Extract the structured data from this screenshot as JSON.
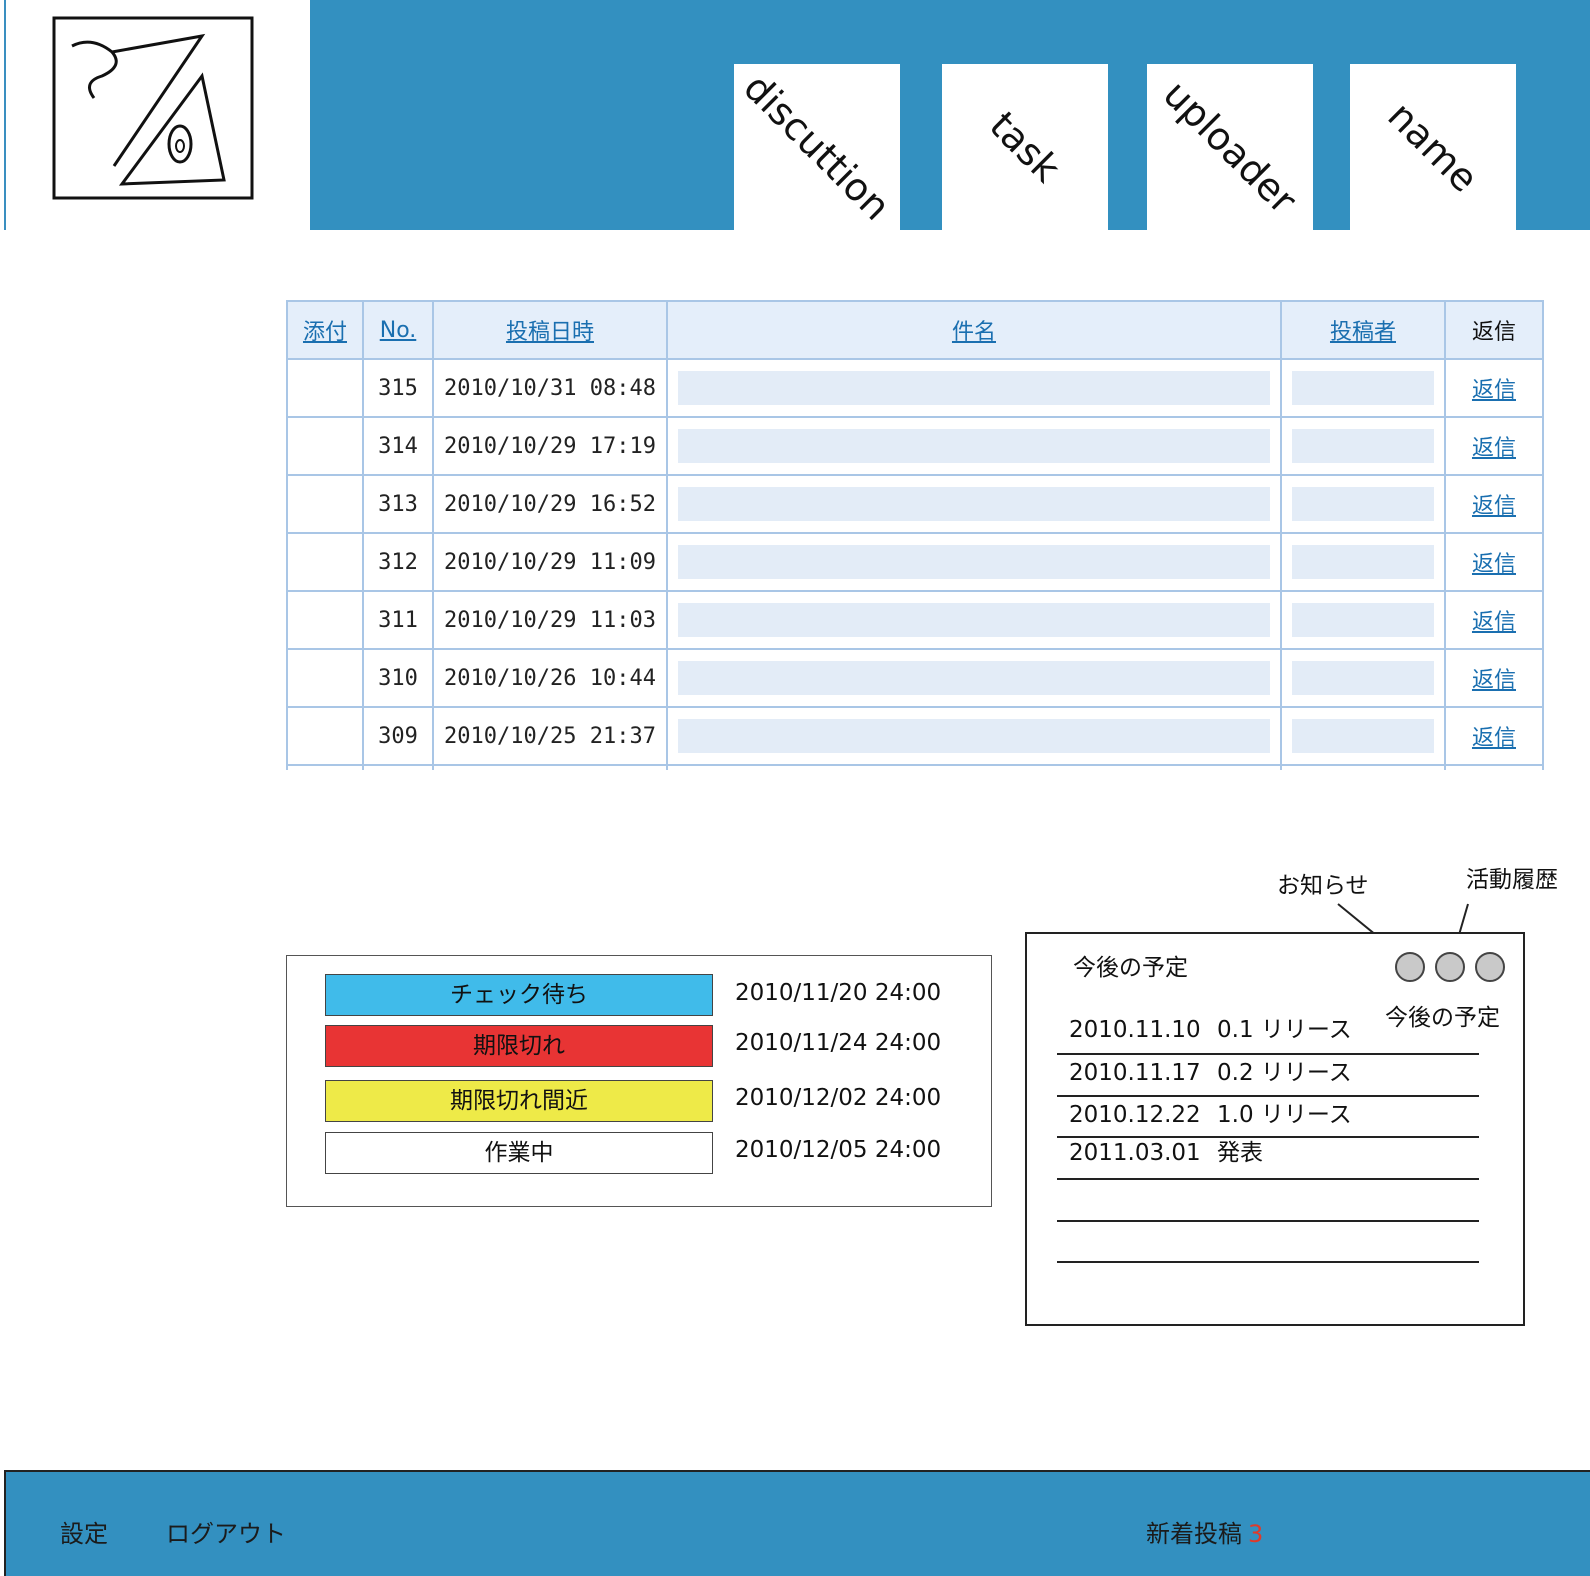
{
  "header": {
    "tabs": [
      "discuttion",
      "task",
      "uploader",
      "name"
    ]
  },
  "table": {
    "columns": [
      "添付",
      "No.",
      "投稿日時",
      "件名",
      "投稿者",
      "返信"
    ],
    "reply_label": "返信",
    "rows": [
      {
        "no": "315",
        "datetime": "2010/10/31 08:48"
      },
      {
        "no": "314",
        "datetime": "2010/10/29 17:19"
      },
      {
        "no": "313",
        "datetime": "2010/10/29 16:52"
      },
      {
        "no": "312",
        "datetime": "2010/10/29 11:09"
      },
      {
        "no": "311",
        "datetime": "2010/10/29 11:03"
      },
      {
        "no": "310",
        "datetime": "2010/10/26 10:44"
      },
      {
        "no": "309",
        "datetime": "2010/10/25 21:37"
      }
    ]
  },
  "legend": {
    "items": [
      {
        "label": "チェック待ち",
        "color": "#40bbea",
        "date": "2010/11/20 24:00"
      },
      {
        "label": "期限切れ",
        "color": "#e83434",
        "date": "2010/11/24 24:00"
      },
      {
        "label": "期限切れ間近",
        "color": "#eeea48",
        "date": "2010/12/02 24:00"
      },
      {
        "label": "作業中",
        "color": "#ffffff",
        "date": "2010/12/05 24:00"
      }
    ]
  },
  "schedule": {
    "title": "今後の予定",
    "callouts": {
      "notice": "お知らせ",
      "activity": "活動履歴",
      "upcoming": "今後の予定"
    },
    "entries": [
      {
        "date": "2010.11.10",
        "text": "0.1 リリース"
      },
      {
        "date": "2010.11.17",
        "text": "0.2 リリース"
      },
      {
        "date": "2010.12.22",
        "text": "1.0 リリース"
      },
      {
        "date": "2011.03.01",
        "text": "発表"
      }
    ]
  },
  "footer": {
    "settings": "設定",
    "logout": "ログアウト",
    "new_posts_label": "新着投稿",
    "new_posts_count": "3"
  },
  "colors": {
    "brand_blue": "#3390c0",
    "table_border": "#a9c6e6",
    "table_fill": "#e3ecf7",
    "link": "#1a6fb0",
    "count": "#e03a2a"
  }
}
